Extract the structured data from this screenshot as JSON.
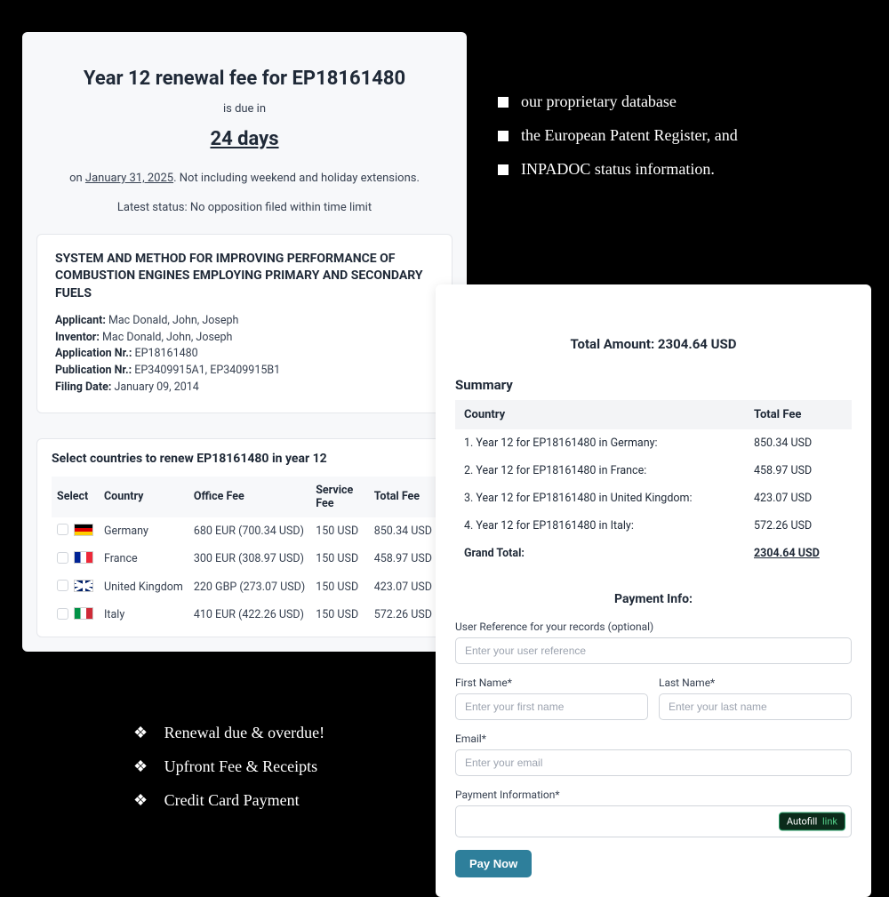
{
  "left": {
    "title": "Year 12 renewal fee for EP18161480",
    "due_in_label": "is due in",
    "days": "24 days",
    "on": "on ",
    "due_date": "January 31, 2025",
    "due_suffix": ". Not including weekend and holiday extensions.",
    "status_prefix": "Latest status: ",
    "status_value": "No opposition filed within time limit",
    "patent": {
      "title": "SYSTEM AND METHOD FOR IMPROVING PERFORMANCE OF COMBUSTION ENGINES EMPLOYING PRIMARY AND SECONDARY FUELS",
      "applicant_label": "Applicant:",
      "applicant": " Mac Donald, John, Joseph",
      "inventor_label": "Inventor:",
      "inventor": " Mac Donald, John, Joseph",
      "appno_label": "Application Nr.:",
      "appno": " EP18161480",
      "pubno_label": "Publication Nr.:",
      "pubno": " EP3409915A1, EP3409915B1",
      "filing_label": "Filing Date:",
      "filing": " January 09, 2014"
    },
    "select_heading": "Select countries to renew EP18161480 in year 12",
    "cols": {
      "select": "Select",
      "country": "Country",
      "office": "Office Fee",
      "service": "Service Fee",
      "total": "Total Fee"
    },
    "rows": [
      {
        "flag": "de",
        "country": "Germany",
        "office": "680 EUR (700.34 USD)",
        "service": "150 USD",
        "total": "850.34 USD"
      },
      {
        "flag": "fr",
        "country": "France",
        "office": "300 EUR (308.97 USD)",
        "service": "150 USD",
        "total": "458.97 USD"
      },
      {
        "flag": "uk",
        "country": "United Kingdom",
        "office": "220 GBP (273.07 USD)",
        "service": "150 USD",
        "total": "423.07 USD"
      },
      {
        "flag": "it",
        "country": "Italy",
        "office": "410 EUR (422.26 USD)",
        "service": "150 USD",
        "total": "572.26 USD"
      }
    ]
  },
  "right": {
    "total_label": "Total Amount: ",
    "total_value": "2304.64 USD",
    "summary_label": "Summary",
    "cols": {
      "country": "Country",
      "total": "Total Fee"
    },
    "items": [
      {
        "line": "1. Year 12 for EP18161480 in Germany:",
        "fee": "850.34 USD"
      },
      {
        "line": "2. Year 12 for EP18161480 in France:",
        "fee": "458.97 USD"
      },
      {
        "line": "3. Year 12 for EP18161480 in United Kingdom:",
        "fee": "423.07 USD"
      },
      {
        "line": "4. Year 12 for EP18161480 in Italy:",
        "fee": "572.26 USD"
      }
    ],
    "grand_label": "Grand Total:",
    "grand_value": "2304.64 USD",
    "payinfo_label": "Payment Info:",
    "ref_label": "User Reference for your records (optional)",
    "ref_ph": "Enter your user reference",
    "fn_label": "First Name*",
    "fn_ph": "Enter your first name",
    "ln_label": "Last Name*",
    "ln_ph": "Enter your last name",
    "email_label": "Email*",
    "email_ph": "Enter your email",
    "paymethod_label": "Payment Information*",
    "autofill": "Autofill",
    "autofill_link": "link",
    "pay_btn": "Pay Now"
  },
  "bullets_tr": [
    "our proprietary database",
    "the European Patent Register, and",
    "INPADOC status information",
    "."
  ],
  "bullets_bl": [
    "Renewal due & overdue!",
    "Upfront Fee & Receipts",
    "Credit Card Payment"
  ]
}
